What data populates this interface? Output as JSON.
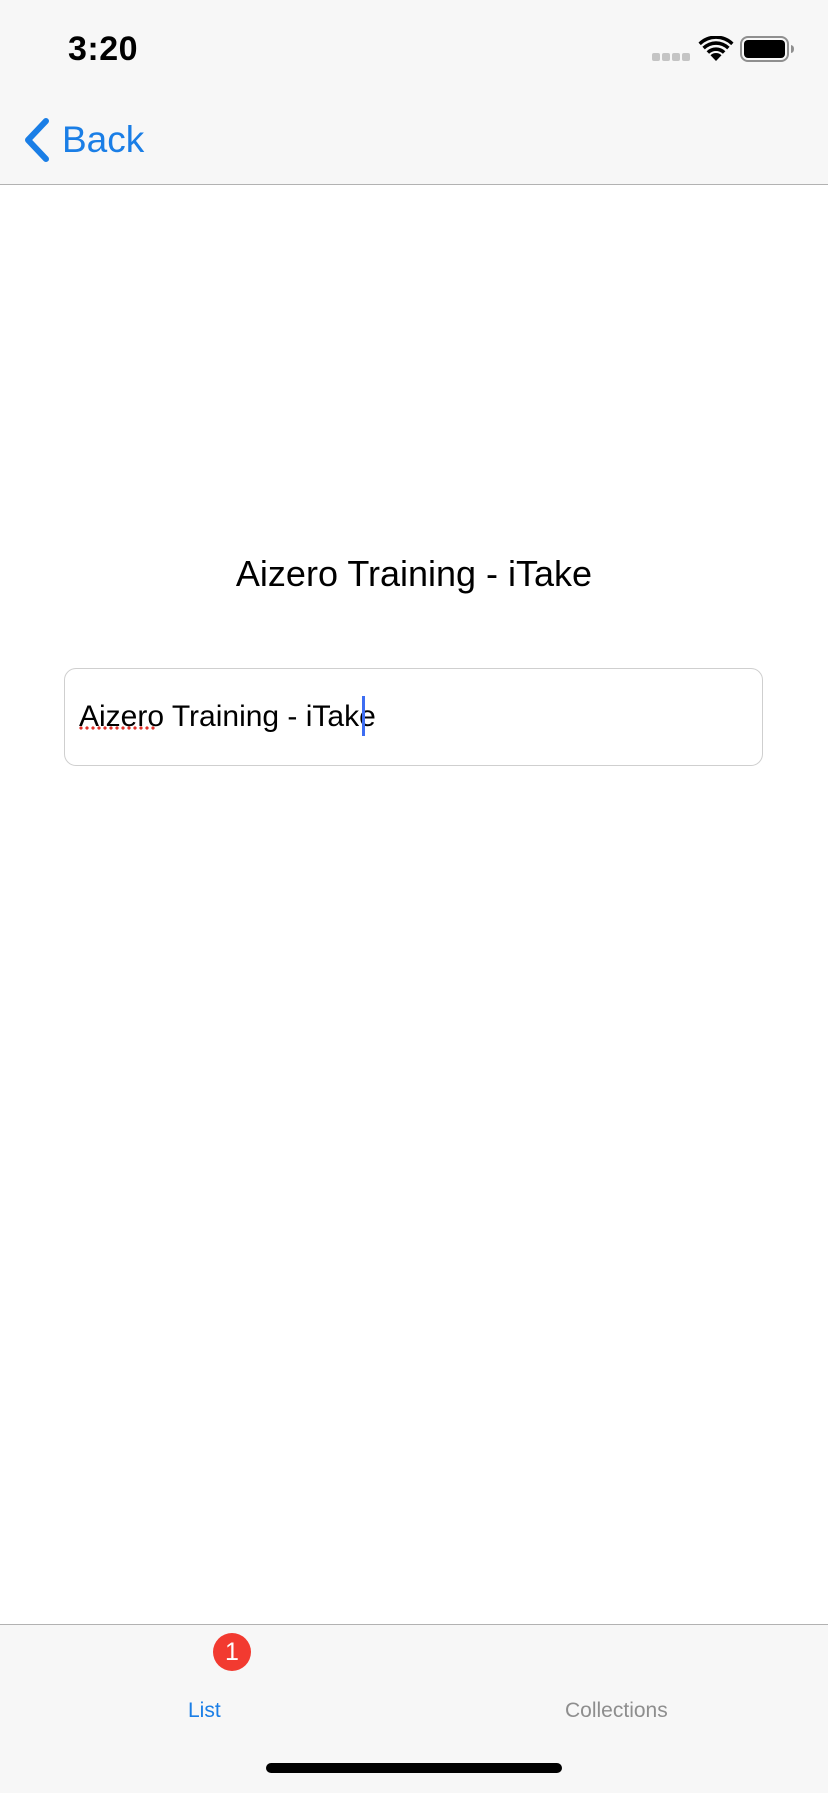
{
  "status_bar": {
    "time": "3:20",
    "icons": [
      "signal-dots-icon",
      "wifi-icon",
      "battery-icon"
    ]
  },
  "nav_bar": {
    "back_label": "Back",
    "back_icon": "chevron-left-icon"
  },
  "main": {
    "title": "Aizero Training - iTake",
    "name_field": {
      "value": "Aizero Training - iTake",
      "placeholder": ""
    }
  },
  "tab_bar": {
    "tabs": [
      {
        "label": "List",
        "badge": "1",
        "selected": true
      },
      {
        "label": "Collections",
        "selected": false
      }
    ]
  },
  "colors": {
    "accent": "#1a7ee6",
    "badge": "#f23a30",
    "bar_background": "#f7f7f7",
    "inactive_tab": "#8e8e8e",
    "caret": "#3d6df2"
  }
}
